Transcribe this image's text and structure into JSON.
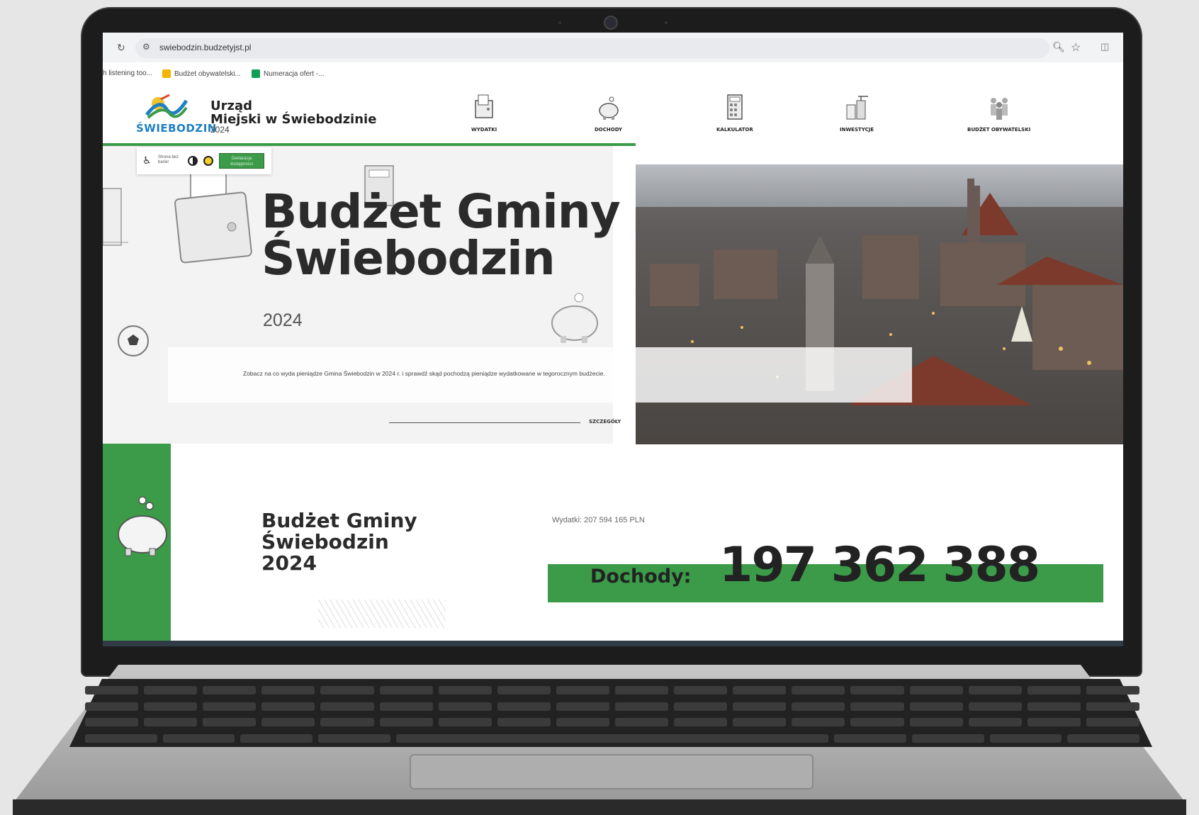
{
  "browser": {
    "url": "swiebodzin.budzetyjst.pl",
    "bookmarks": [
      {
        "label": "h listening too...",
        "color": ""
      },
      {
        "label": "Budżet obywatelski...",
        "color": "#f4b400"
      },
      {
        "label": "Numeracja ofert -...",
        "color": "#0f9d58"
      }
    ]
  },
  "logo": {
    "gmina": "ŚWIEBODZIN",
    "urzad_line1": "Urząd",
    "urzad_line2": "Miejski w Świebodzinie",
    "year": "2024"
  },
  "nav": {
    "items": [
      {
        "label": "WYDATKI",
        "icon": "wallet-icon"
      },
      {
        "label": "DOCHODY",
        "icon": "piggy-bank-icon"
      },
      {
        "label": "KALKULATOR",
        "icon": "calculator-icon"
      },
      {
        "label": "INWESTYCJE",
        "icon": "construction-icon"
      },
      {
        "label": "BUDŻET OBYWATELSKI",
        "icon": "people-icon"
      }
    ]
  },
  "accessibility": {
    "barrier_free": "Strona bez barier",
    "declaration": "Deklaracja dostępności"
  },
  "hero": {
    "title_line1": "Budżet Gminy",
    "title_line2": "Świebodzin",
    "year": "2024",
    "description": "Zobacz na co wyda pieniądze Gmina Świebodzin w 2024 r. i sprawdź skąd pochodzą pieniądze wydatkowane w tegorocznym budżecie.",
    "details_link": "SZCZEGÓŁY"
  },
  "summary": {
    "title_line1": "Budżet Gminy",
    "title_line2": "Świebodzin",
    "title_line3": "2024",
    "expenses": "Wydatki: 207 594 165 PLN",
    "income_label": "Dochody:",
    "income_value": "197 362 388"
  },
  "colors": {
    "accent_green": "#3b9b48",
    "logo_blue": "#1f7fc1"
  }
}
